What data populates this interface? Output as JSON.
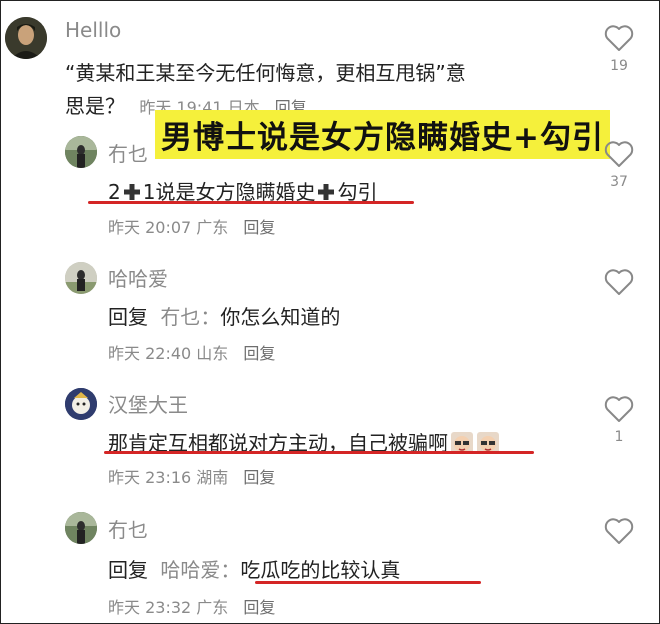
{
  "overlay_caption": "男博士说是女方隐瞒婚史+勾引",
  "comments": [
    {
      "username": "Helllo",
      "text_line1": "“黄某和王某至今无任何悔意，更相互甩锅”意",
      "text_line2": "思是？",
      "time": "昨天 19:41",
      "location": "日本",
      "reply_label": "回复",
      "likes": "19"
    },
    {
      "username": "冇乜",
      "text_part1": "2",
      "text_part2": "1说是女方隐瞒婚史",
      "text_part3": "勾引",
      "time": "昨天 20:07",
      "location": "广东",
      "reply_label": "回复",
      "likes": "37"
    },
    {
      "username": "哈哈爱",
      "reply_prefix": "回复",
      "mention": "冇乜：",
      "text": "你怎么知道的",
      "time": "昨天 22:40",
      "location": "山东",
      "reply_label": "回复",
      "likes": ""
    },
    {
      "username": "汉堡大王",
      "text": "那肯定互相都说对方主动，自己被骗啊",
      "time": "昨天 23:16",
      "location": "湖南",
      "reply_label": "回复",
      "likes": "1"
    },
    {
      "username": "冇乜",
      "reply_prefix": "回复",
      "mention": "哈哈爱：",
      "text": "吃瓜吃的比较认真",
      "time": "昨天 23:32",
      "location": "广东",
      "reply_label": "回复",
      "likes": ""
    }
  ],
  "colors": {
    "highlight_underline": "#d42525",
    "caption_background": "#f5f03b",
    "secondary_text": "#8a8a8a"
  }
}
